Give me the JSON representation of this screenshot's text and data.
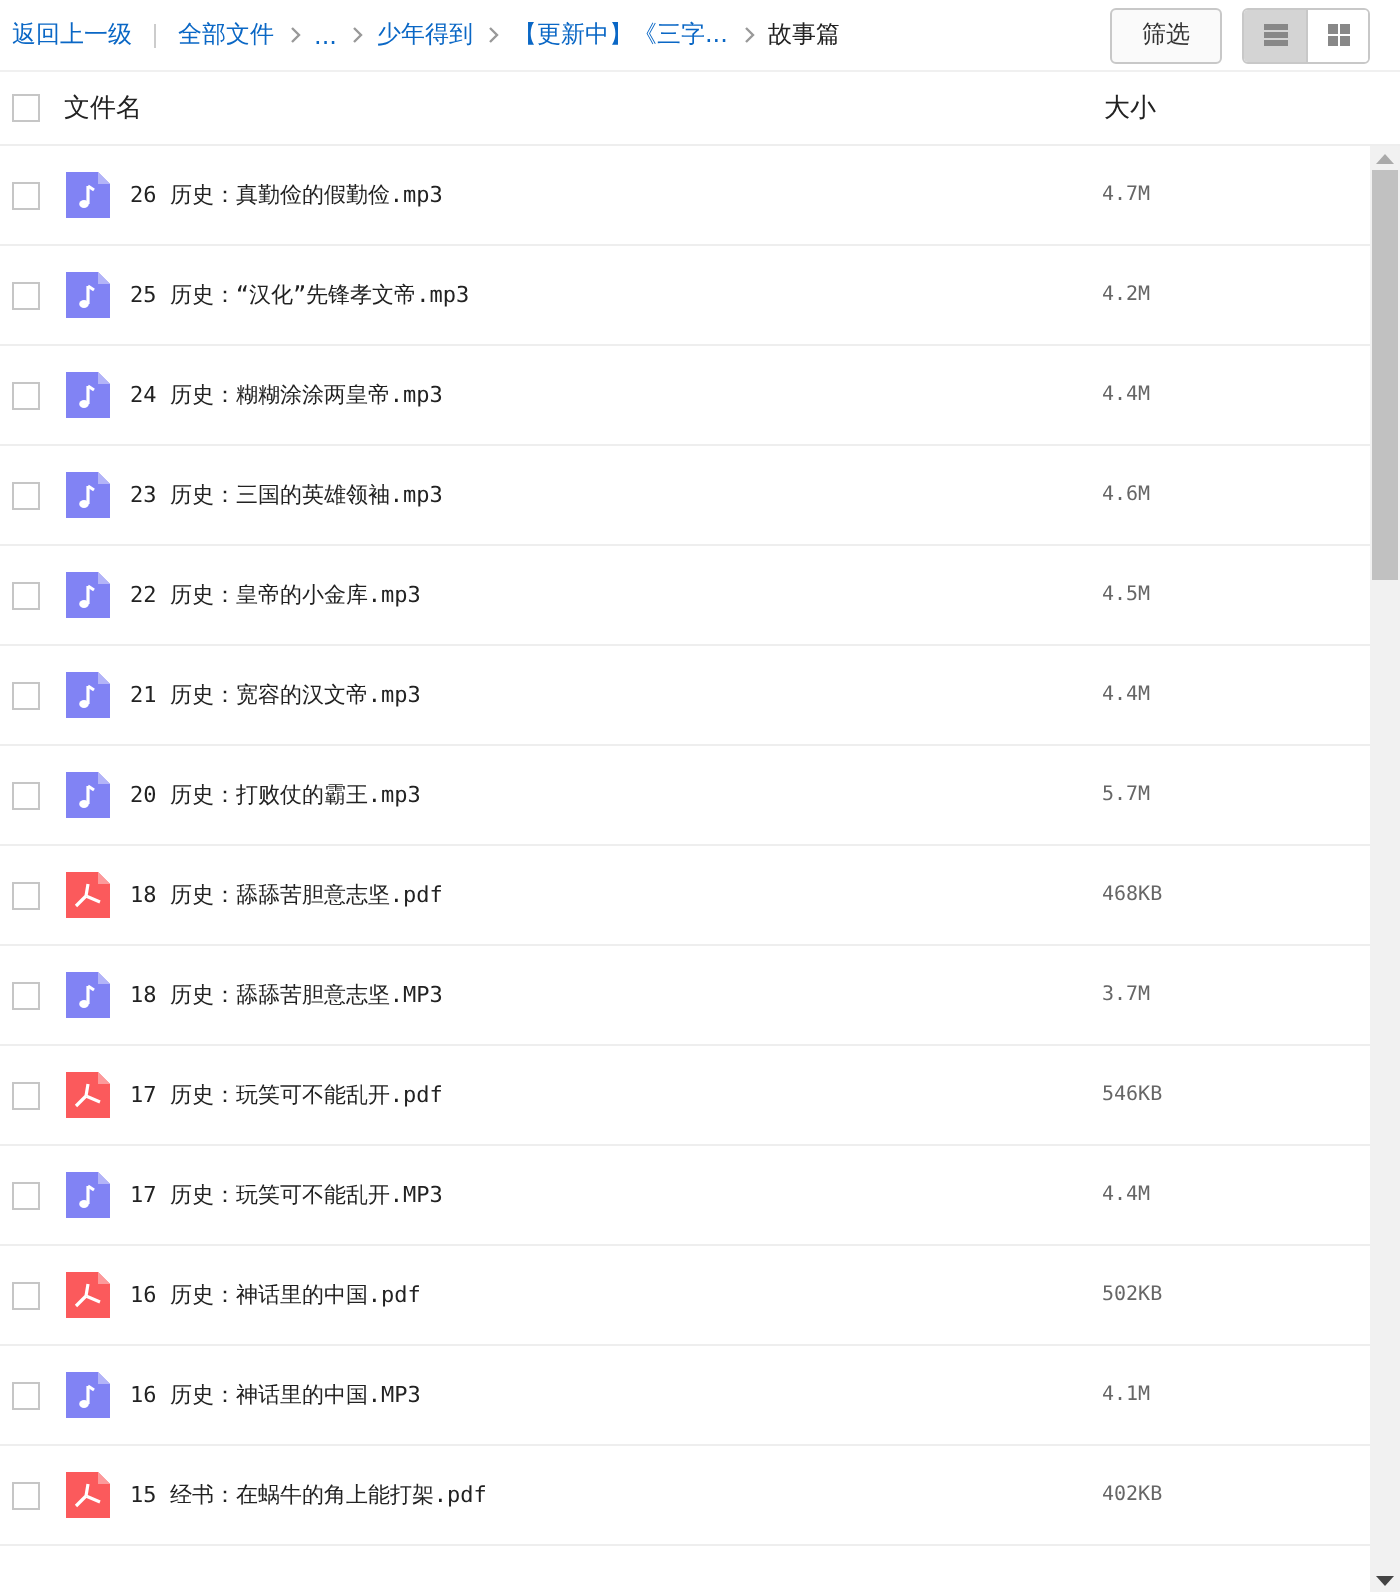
{
  "breadcrumb": {
    "back": "返回上一级",
    "items": [
      {
        "label": "全部文件",
        "current": false
      },
      {
        "label": "...",
        "current": false
      },
      {
        "label": "少年得到",
        "current": false
      },
      {
        "label": "【更新中】《三字...",
        "current": false
      },
      {
        "label": "故事篇",
        "current": true
      }
    ]
  },
  "filter_button": "筛选",
  "view_modes": [
    {
      "kind": "list",
      "selected": true
    },
    {
      "kind": "grid",
      "selected": false
    }
  ],
  "table": {
    "select_all_checked": false,
    "columns": [
      "文件名",
      "大小"
    ],
    "rows": [
      {
        "kind": "audio",
        "name": "26 历史：真勤俭的假勤俭.mp3",
        "size": "4.7M",
        "checked": false
      },
      {
        "kind": "audio",
        "name": "25 历史：“汉化”先锋孝文帝.mp3",
        "size": "4.2M",
        "checked": false
      },
      {
        "kind": "audio",
        "name": "24 历史：糊糊涂涂两皇帝.mp3",
        "size": "4.4M",
        "checked": false
      },
      {
        "kind": "audio",
        "name": "23 历史：三国的英雄领袖.mp3",
        "size": "4.6M",
        "checked": false
      },
      {
        "kind": "audio",
        "name": "22 历史：皇帝的小金库.mp3",
        "size": "4.5M",
        "checked": false
      },
      {
        "kind": "audio",
        "name": "21 历史：宽容的汉文帝.mp3",
        "size": "4.4M",
        "checked": false
      },
      {
        "kind": "audio",
        "name": "20 历史：打败仗的霸王.mp3",
        "size": "5.7M",
        "checked": false
      },
      {
        "kind": "pdf",
        "name": "18 历史：舔舔苦胆意志坚.pdf",
        "size": "468KB",
        "checked": false
      },
      {
        "kind": "audio",
        "name": "18 历史：舔舔苦胆意志坚.MP3",
        "size": "3.7M",
        "checked": false
      },
      {
        "kind": "pdf",
        "name": "17 历史：玩笑可不能乱开.pdf",
        "size": "546KB",
        "checked": false
      },
      {
        "kind": "audio",
        "name": "17 历史：玩笑可不能乱开.MP3",
        "size": "4.4M",
        "checked": false
      },
      {
        "kind": "pdf",
        "name": "16 历史：神话里的中国.pdf",
        "size": "502KB",
        "checked": false
      },
      {
        "kind": "audio",
        "name": "16 历史：神话里的中国.MP3",
        "size": "4.1M",
        "checked": false
      },
      {
        "kind": "pdf",
        "name": "15 经书：在蜗牛的角上能打架.pdf",
        "size": "402KB",
        "checked": false
      }
    ]
  }
}
